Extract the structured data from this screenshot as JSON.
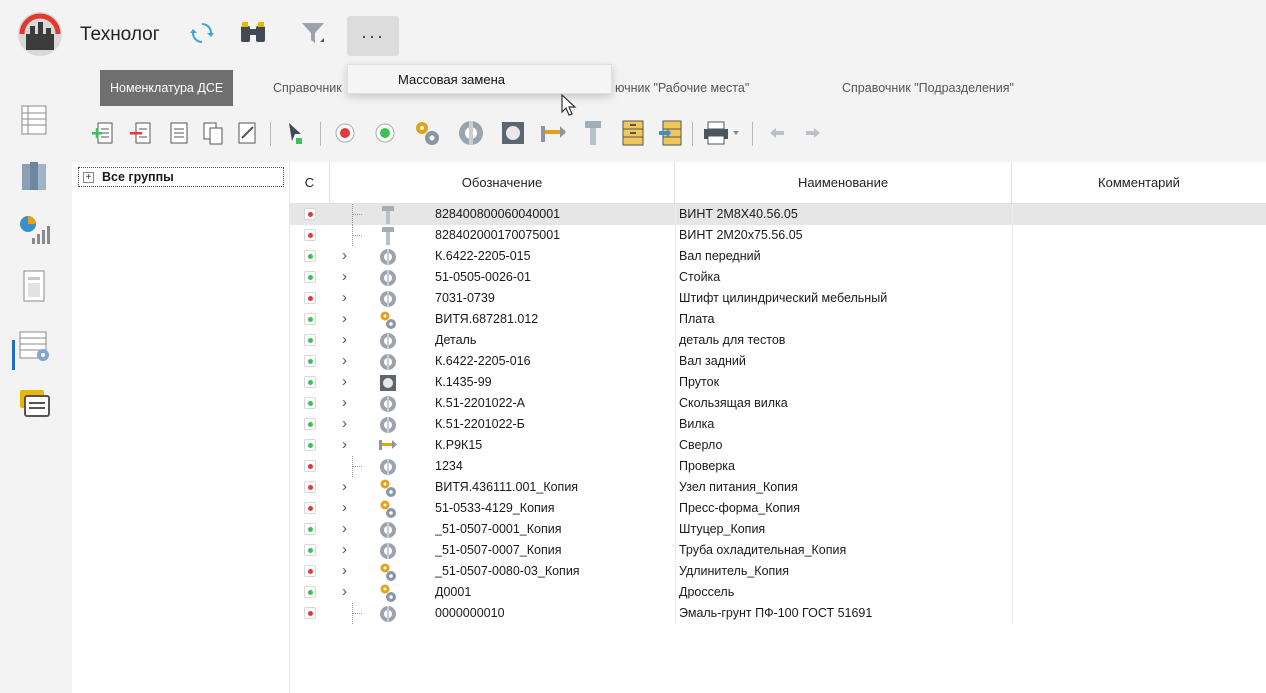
{
  "app": {
    "title": "Технолог"
  },
  "titlebar": {
    "icons": [
      "refresh-icon",
      "binoculars-icon",
      "filter-icon"
    ],
    "more_label": "···"
  },
  "menu": {
    "items": [
      "Массовая замена"
    ]
  },
  "tabs": [
    {
      "label": "Номенклатура ДСЕ",
      "active": true
    },
    {
      "label": "Справочник",
      "active": false
    },
    {
      "label": "Справочник \"Рабочие места\"",
      "visible_text": "ючник \"Рабочие места\"",
      "active": false
    },
    {
      "label": "Справочник \"Подразделения\"",
      "active": false
    }
  ],
  "toolbar": {
    "icons": [
      "add-row-icon",
      "remove-row-icon",
      "copy-icon",
      "edit-icon",
      "cursor-icon",
      "red-status-icon",
      "green-status-icon",
      "gears-icon",
      "circle-part-icon",
      "square-part-icon",
      "drill-icon",
      "bolt-icon",
      "cabinet-icon",
      "cabinet-arrow-icon",
      "printer-icon",
      "back-arrow-icon",
      "forward-arrow-icon"
    ]
  },
  "colors": {
    "red": "#e23a3a",
    "green": "#3fbf55",
    "accent": "#1f6fc5",
    "selected_row": "#e6e6e6"
  },
  "tree": {
    "root_label": "Все группы",
    "expander": "+"
  },
  "grid": {
    "columns": {
      "status": "С",
      "designation": "Обозначение",
      "name": "Наименование",
      "comment": "Комментарий"
    },
    "rows": [
      {
        "status": "red",
        "kind": "bolt",
        "expand": false,
        "designation": "828400800060040001",
        "name": "ВИНТ 2М8Х40.56.05",
        "selected": true
      },
      {
        "status": "red",
        "kind": "bolt",
        "expand": false,
        "designation": "828402000170075001",
        "name": "ВИНТ 2М20х75.56.05"
      },
      {
        "status": "green",
        "kind": "circle",
        "expand": true,
        "designation": "К.6422-2205-015",
        "name": "Вал передний"
      },
      {
        "status": "green",
        "kind": "circle",
        "expand": true,
        "designation": "51-0505-0026-01",
        "name": "Стойка"
      },
      {
        "status": "red",
        "kind": "circle",
        "expand": true,
        "designation": "7031-0739",
        "name": "Штифт цилиндрический мебельный"
      },
      {
        "status": "green",
        "kind": "gears",
        "expand": true,
        "designation": "ВИТЯ.687281.012",
        "name": "Плата"
      },
      {
        "status": "green",
        "kind": "circle",
        "expand": true,
        "designation": "Деталь",
        "name": "деталь для тестов"
      },
      {
        "status": "green",
        "kind": "circle",
        "expand": true,
        "designation": "К.6422-2205-016",
        "name": "Вал задний"
      },
      {
        "status": "green",
        "kind": "square",
        "expand": true,
        "designation": "К.1435-99",
        "name": "Пруток"
      },
      {
        "status": "green",
        "kind": "circle",
        "expand": true,
        "designation": "К.51-2201022-А",
        "name": "Скользящая вилка"
      },
      {
        "status": "green",
        "kind": "circle",
        "expand": true,
        "designation": "К.51-2201022-Б",
        "name": "Вилка"
      },
      {
        "status": "green",
        "kind": "drill",
        "expand": true,
        "designation": "К.Р9К15",
        "name": "Сверло"
      },
      {
        "status": "red",
        "kind": "circle",
        "expand": false,
        "designation": "1234",
        "name": "Проверка"
      },
      {
        "status": "red",
        "kind": "gears",
        "expand": true,
        "designation": "ВИТЯ.436111.001_Копия",
        "name": "Узел питания_Копия"
      },
      {
        "status": "red",
        "kind": "gears",
        "expand": true,
        "designation": "51-0533-4129_Копия",
        "name": "Пресс-форма_Копия"
      },
      {
        "status": "green",
        "kind": "circle",
        "expand": true,
        "designation": "_51-0507-0001_Копия",
        "name": "Штуцер_Копия"
      },
      {
        "status": "green",
        "kind": "circle",
        "expand": true,
        "designation": "_51-0507-0007_Копия",
        "name": "Труба охладительная_Копия"
      },
      {
        "status": "red",
        "kind": "gears",
        "expand": true,
        "designation": "_51-0507-0080-03_Копия",
        "name": "Удлинитель_Копия"
      },
      {
        "status": "green",
        "kind": "gears",
        "expand": true,
        "designation": "Д0001",
        "name": "Дроссель"
      },
      {
        "status": "red",
        "kind": "circle",
        "expand": false,
        "designation": "0000000010",
        "name": "Эмаль-грунт ПФ-100 ГОСТ 51691"
      }
    ]
  }
}
